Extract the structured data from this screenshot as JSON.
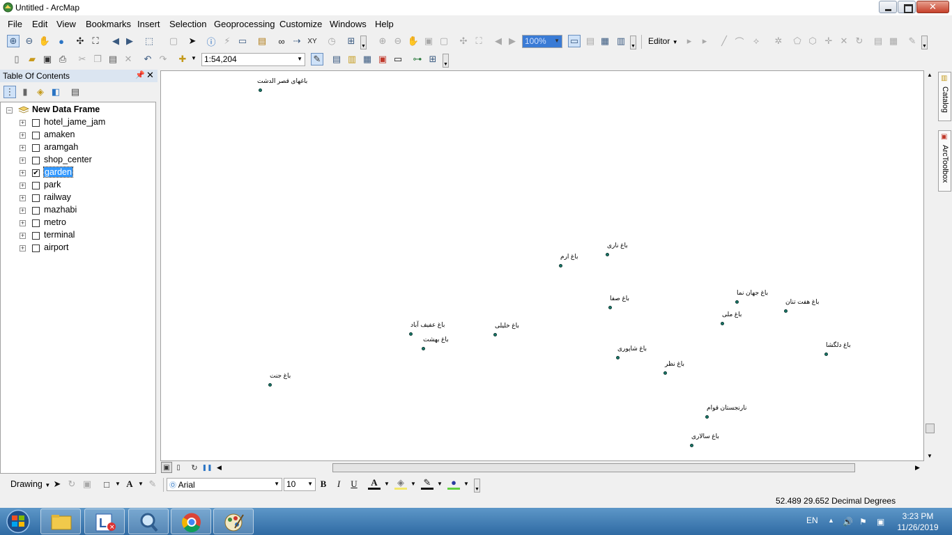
{
  "window": {
    "title": "Untitled - ArcMap"
  },
  "menu": [
    "File",
    "Edit",
    "View",
    "Bookmarks",
    "Insert",
    "Selection",
    "Geoprocessing",
    "Customize",
    "Windows",
    "Help"
  ],
  "toolbar": {
    "zoom_percent": "100%",
    "editor_label": "Editor",
    "scale": "1:54,204"
  },
  "toc": {
    "title": "Table Of Contents",
    "data_frame": "New Data Frame",
    "layers": [
      {
        "name": "hotel_jame_jam",
        "checked": false
      },
      {
        "name": "amaken",
        "checked": false
      },
      {
        "name": "aramgah",
        "checked": false
      },
      {
        "name": "shop_center",
        "checked": false
      },
      {
        "name": "garden",
        "checked": true
      },
      {
        "name": "park",
        "checked": false
      },
      {
        "name": "railway",
        "checked": false
      },
      {
        "name": "mazhabi",
        "checked": false
      },
      {
        "name": "metro",
        "checked": false
      },
      {
        "name": "terminal",
        "checked": false
      },
      {
        "name": "airport",
        "checked": false
      }
    ],
    "selected_layer": "garden"
  },
  "map": {
    "features": [
      "باغهای قصر الدشت",
      "باغ ناری",
      "باغ ارم",
      "باغ صفا",
      "باغ جهان نما",
      "باغ هفت تنان",
      "باغ ملی",
      "باغ عفیف آباد",
      "باغ خلیلی",
      "باغ بهشت",
      "باغ دلگشا",
      "باغ شاپوری",
      "باغ نظر",
      "باغ جنت",
      "نارنجستان قوام",
      "باغ سالاری"
    ]
  },
  "side_tabs": [
    "Catalog",
    "ArcToolbox"
  ],
  "drawing": {
    "label": "Drawing",
    "font": "Arial",
    "font_size": "10",
    "bold": "B",
    "italic": "I",
    "underline": "U"
  },
  "status": {
    "coordinates": "52.489  29.652 Decimal Degrees"
  },
  "taskbar": {
    "language": "EN",
    "time": "3:23 PM",
    "date": "11/26/2019"
  }
}
